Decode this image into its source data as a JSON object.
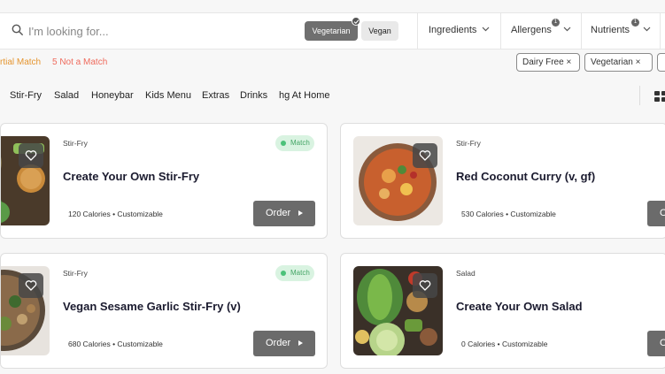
{
  "search": {
    "placeholder": "I'm looking for..."
  },
  "diet_chips": [
    {
      "label": "Vegetarian",
      "selected": true
    },
    {
      "label": "Vegan",
      "selected": false
    }
  ],
  "filters": [
    {
      "label": "Ingredients",
      "badge": ""
    },
    {
      "label": "Allergens",
      "badge": "1"
    },
    {
      "label": "Nutrients",
      "badge": "1"
    }
  ],
  "status": {
    "partial_match": "rtial Match",
    "not_match": "5 Not a Match"
  },
  "active_tags": [
    "Dairy Free ×",
    "Vegetarian ×"
  ],
  "categories": [
    "Stir-Fry",
    "Salad",
    "Honeybar",
    "Kids Menu",
    "Extras",
    "Drinks",
    "hg At Home"
  ],
  "menu_items": [
    {
      "category": "Stir-Fry",
      "title": "Create Your Own Stir-Fry",
      "meta": "120 Calories • Customizable",
      "match": "Match",
      "order": "Order",
      "image": "stir-fry-ingredients"
    },
    {
      "category": "Stir-Fry",
      "title": "Red Coconut Curry (v, gf)",
      "meta": "530 Calories • Customizable",
      "match": "",
      "order": "O",
      "image": "curry-noodles"
    },
    {
      "category": "Stir-Fry",
      "title": "Vegan Sesame Garlic Stir-Fry (v)",
      "meta": "680 Calories • Customizable",
      "match": "Match",
      "order": "Order",
      "image": "sesame-stir-fry"
    },
    {
      "category": "Salad",
      "title": "Create Your Own Salad",
      "meta": "0 Calories • Customizable",
      "match": "",
      "order": "O",
      "image": "salad-ingredients"
    }
  ],
  "colors": {
    "accent_dark": "#6b6b6b",
    "match_bg": "#d9f3e1",
    "partial": "#e5952f",
    "not_match": "#ef6b5d"
  }
}
